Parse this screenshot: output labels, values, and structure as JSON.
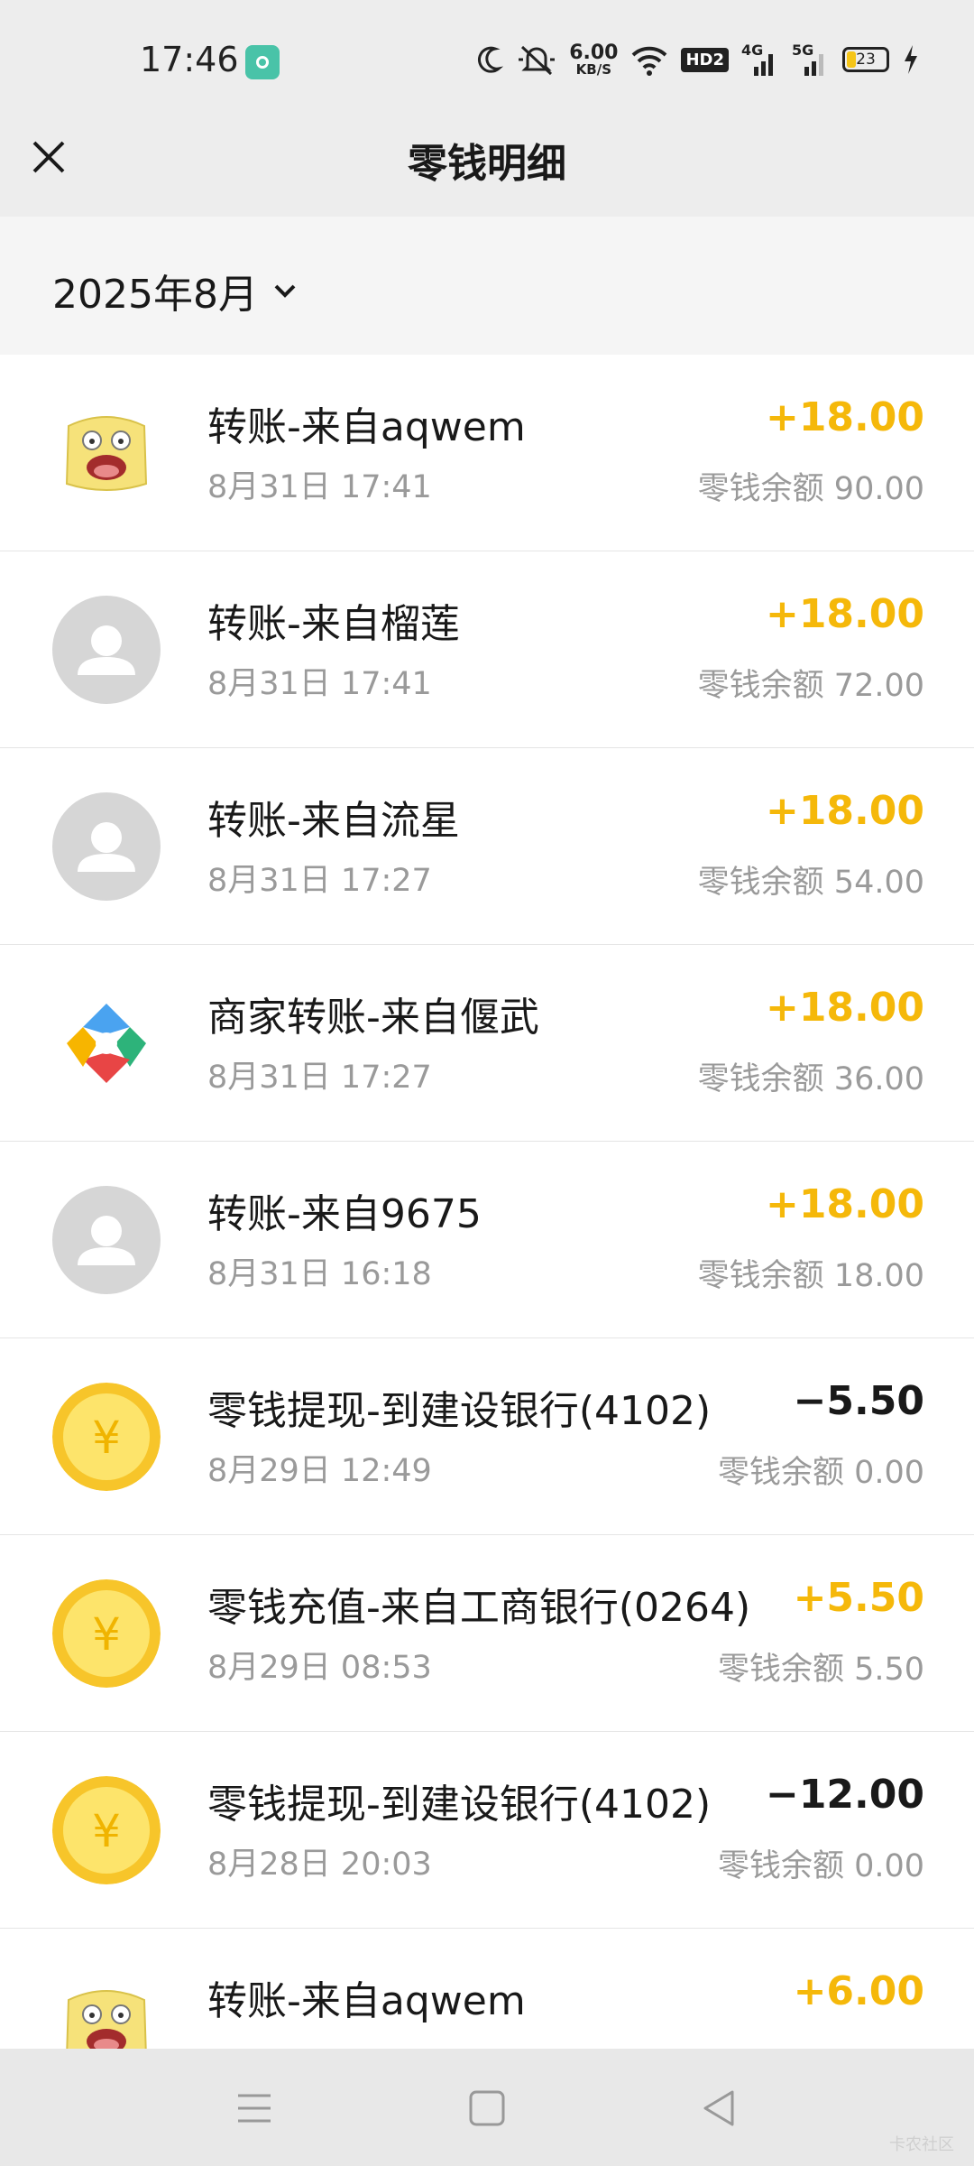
{
  "status_bar": {
    "time": "17:46",
    "net_speed_value": "6.00",
    "net_speed_unit": "KB/S",
    "hd_label": "HD2",
    "net1": "4G",
    "net2": "5G",
    "battery": "23",
    "icons": [
      "app-icon",
      "moon-icon",
      "mute-icon",
      "wifi-icon",
      "signal-icon",
      "charging-icon"
    ]
  },
  "header": {
    "title": "零钱明细",
    "close_icon": "close-icon"
  },
  "month": {
    "label": "2025年8月",
    "icon": "chevron-down-icon"
  },
  "colors": {
    "positive": "#f5b80a",
    "negative": "#191919",
    "secondary": "#9a9a9a",
    "background": "#ededed"
  },
  "transactions": [
    {
      "avatar": "cartoon",
      "title": "转账-来自aqwem",
      "date": "8月31日 17:41",
      "amount": "+18.00",
      "balance": "零钱余额 90.00"
    },
    {
      "avatar": "default",
      "title": "转账-来自榴莲",
      "date": "8月31日 17:41",
      "amount": "+18.00",
      "balance": "零钱余额 72.00"
    },
    {
      "avatar": "default",
      "title": "转账-来自流星",
      "date": "8月31日 17:27",
      "amount": "+18.00",
      "balance": "零钱余额 54.00"
    },
    {
      "avatar": "merchant",
      "title": "商家转账-来自偃武",
      "date": "8月31日 17:27",
      "amount": "+18.00",
      "balance": "零钱余额 36.00"
    },
    {
      "avatar": "default",
      "title": "转账-来自9675",
      "date": "8月31日 16:18",
      "amount": "+18.00",
      "balance": "零钱余额 18.00"
    },
    {
      "avatar": "coin",
      "title": "零钱提现-到建设银行(4102)",
      "date": "8月29日 12:49",
      "amount": "−5.50",
      "balance": "零钱余额 0.00"
    },
    {
      "avatar": "coin",
      "title": "零钱充值-来自工商银行(0264)",
      "date": "8月29日 08:53",
      "amount": "+5.50",
      "balance": "零钱余额 5.50"
    },
    {
      "avatar": "coin",
      "title": "零钱提现-到建设银行(4102)",
      "date": "8月28日 20:03",
      "amount": "−12.00",
      "balance": "零钱余额 0.00"
    },
    {
      "avatar": "cartoon",
      "title": "转账-来自aqwem",
      "date": "",
      "amount": "+6.00",
      "balance": ""
    }
  ],
  "nav_bar": {
    "icons": [
      "menu-icon",
      "home-icon",
      "back-icon"
    ]
  },
  "watermark": "卡农社区"
}
